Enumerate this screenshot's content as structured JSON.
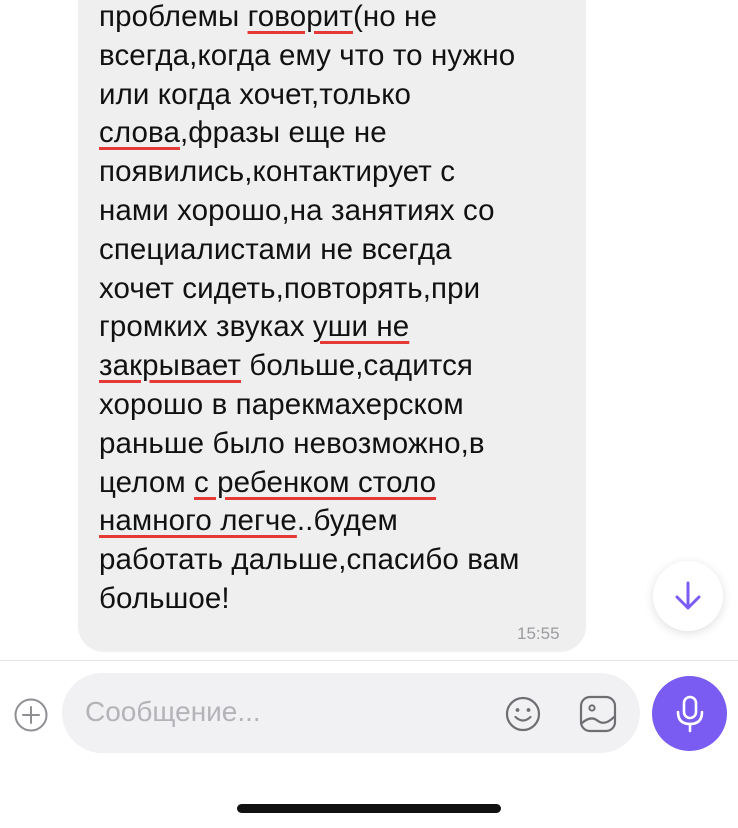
{
  "message": {
    "lines": [
      {
        "segments": [
          {
            "text": "проблемы ",
            "u": false
          },
          {
            "text": "говорит",
            "u": true
          },
          {
            "text": "(но не",
            "u": false
          }
        ]
      },
      {
        "segments": [
          {
            "text": "всегда,когда ему что то нужно",
            "u": false
          }
        ]
      },
      {
        "segments": [
          {
            "text": "или когда хочет,только",
            "u": false
          }
        ]
      },
      {
        "segments": [
          {
            "text": "слова",
            "u": true
          },
          {
            "text": ",фразы еще не",
            "u": false
          }
        ]
      },
      {
        "segments": [
          {
            "text": "появились,контактирует с",
            "u": false
          }
        ]
      },
      {
        "segments": [
          {
            "text": "нами хорошо,на занятиях со",
            "u": false
          }
        ]
      },
      {
        "segments": [
          {
            "text": "специалистами не всегда",
            "u": false
          }
        ]
      },
      {
        "segments": [
          {
            "text": "хочет сидеть,повторять,при",
            "u": false
          }
        ]
      },
      {
        "segments": [
          {
            "text": "громких звуках ",
            "u": false
          },
          {
            "text": "уши не",
            "u": true
          }
        ]
      },
      {
        "segments": [
          {
            "text": "закрывает",
            "u": true
          },
          {
            "text": " больше,садится",
            "u": false
          }
        ]
      },
      {
        "segments": [
          {
            "text": "хорошо в парекмахерском",
            "u": false
          }
        ]
      },
      {
        "segments": [
          {
            "text": "раньше было невозможно,в",
            "u": false
          }
        ]
      },
      {
        "segments": [
          {
            "text": "целом ",
            "u": false
          },
          {
            "text": "с ребенком столо",
            "u": true
          }
        ]
      },
      {
        "segments": [
          {
            "text": "намного легче",
            "u": true
          },
          {
            "text": "..будем",
            "u": false
          }
        ]
      },
      {
        "segments": [
          {
            "text": "работать дальше,спасибо вам",
            "u": false
          }
        ]
      },
      {
        "segments": [
          {
            "text": "большое!",
            "u": false
          }
        ]
      }
    ],
    "time": "15:55",
    "underline_color": "#e53935"
  },
  "composer": {
    "placeholder": "Сообщение...",
    "add_icon": "plus-circle-icon",
    "emoji_icon": "smile-icon",
    "sticker_icon": "sticker-icon",
    "mic_icon": "microphone-icon",
    "accent_color": "#7a5cf2"
  },
  "scroll_button": {
    "icon": "arrow-down-icon"
  }
}
